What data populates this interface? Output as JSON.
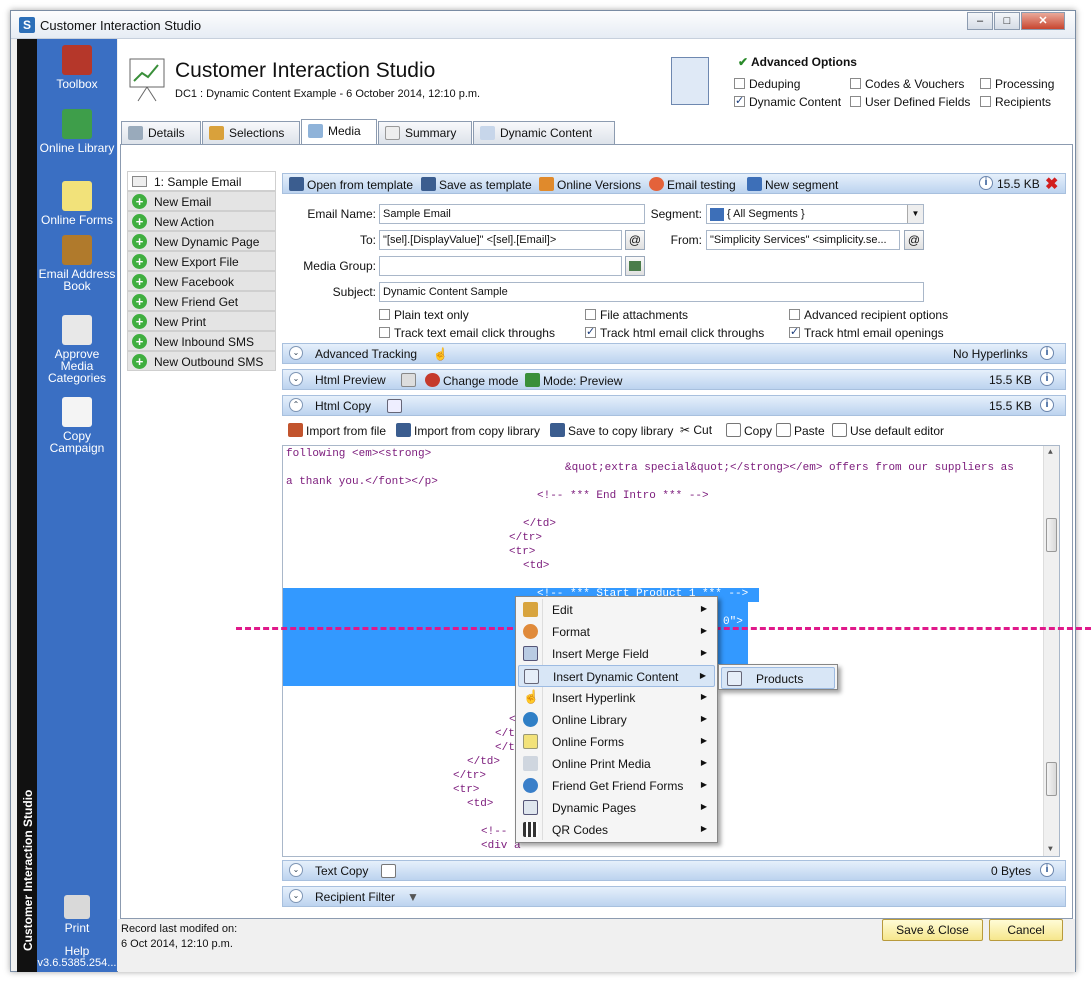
{
  "window": {
    "title": "Customer Interaction Studio"
  },
  "sidebar": {
    "vertical_label": "Customer Interaction Studio",
    "items": [
      {
        "label": "Toolbox",
        "icon": "toolbox-icon"
      },
      {
        "label": "Online Library",
        "icon": "globe-icon"
      },
      {
        "label": "Online Forms",
        "icon": "form-icon"
      },
      {
        "label": "Email Address Book",
        "icon": "address-book-icon"
      },
      {
        "label": "Approve Media Categories",
        "icon": "approve-icon"
      },
      {
        "label": "Copy Campaign",
        "icon": "copy-icon"
      },
      {
        "label": "Print",
        "icon": "printer-icon"
      },
      {
        "label": "Help",
        "icon": "help-icon"
      }
    ],
    "version": "v3.6.5385.254..."
  },
  "header": {
    "title": "Customer Interaction Studio",
    "subtitle": "DC1 : Dynamic Content Example - 6 October 2014, 12:10 p.m."
  },
  "advanced_options": {
    "title": "Advanced Options",
    "options": [
      {
        "label": "Deduping",
        "checked": false
      },
      {
        "label": "Codes & Vouchers",
        "checked": false
      },
      {
        "label": "Processing",
        "checked": false
      },
      {
        "label": "Dynamic Content",
        "checked": true
      },
      {
        "label": "User Defined Fields",
        "checked": false
      },
      {
        "label": "Recipients",
        "checked": false
      }
    ]
  },
  "tabs": [
    {
      "label": "Details"
    },
    {
      "label": "Selections"
    },
    {
      "label": "Media"
    },
    {
      "label": "Summary"
    },
    {
      "label": "Dynamic Content"
    }
  ],
  "email_list": [
    {
      "label": "1: Sample Email"
    },
    {
      "label": "New Email"
    },
    {
      "label": "New Action"
    },
    {
      "label": "New Dynamic Page"
    },
    {
      "label": "New Export File"
    },
    {
      "label": "New Facebook"
    },
    {
      "label": "New Friend Get Friend"
    },
    {
      "label": "New Print"
    },
    {
      "label": "New Inbound SMS"
    },
    {
      "label": "New Outbound SMS"
    }
  ],
  "toolbar": {
    "open_template": "Open from template",
    "save_template": "Save as template",
    "online_versions": "Online Versions",
    "email_testing": "Email testing",
    "new_segment": "New segment",
    "size": "15.5 KB"
  },
  "form": {
    "email_name_label": "Email Name:",
    "email_name": "Sample Email",
    "segment_label": "Segment:",
    "segment": "{ All Segments }",
    "to_label": "To:",
    "to": "\"[sel].[DisplayValue]\" <[sel].[Email]>",
    "from_label": "From:",
    "from": "\"Simplicity Services\" <simplicity.se...",
    "media_group_label": "Media Group:",
    "media_group": "",
    "subject_label": "Subject:",
    "subject": "Dynamic Content Sample"
  },
  "options": [
    {
      "label": "Plain text only",
      "checked": false
    },
    {
      "label": "File attachments",
      "checked": false
    },
    {
      "label": "Advanced recipient options",
      "checked": false
    },
    {
      "label": "Track text email click throughs",
      "checked": false
    },
    {
      "label": "Track html email click throughs",
      "checked": true
    },
    {
      "label": "Track html email openings",
      "checked": true
    }
  ],
  "sections": {
    "advanced_tracking": "Advanced Tracking",
    "no_hyperlinks": "No Hyperlinks",
    "html_preview": "Html Preview",
    "change_mode": "Change mode",
    "mode": "Mode: Preview",
    "preview_size": "15.5 KB",
    "html_copy": "Html Copy",
    "copy_size": "15.5 KB",
    "text_copy": "Text Copy",
    "text_size": "0 Bytes",
    "recipient_filter": "Recipient Filter"
  },
  "copy_toolbar": {
    "import_file": "Import from file",
    "import_library": "Import from copy library",
    "save_library": "Save to copy library",
    "cut": "Cut",
    "copy": "Copy",
    "paste": "Paste",
    "default_editor": "Use default editor"
  },
  "code_lines": [
    "following <em><strong>",
    "&quot;extra special&quot;</strong></em> offers from our suppliers as",
    "a thank you.</font></p>",
    "<!-- *** End Intro *** -->",
    "</td>",
    "</tr>",
    "<tr>",
    "<td>",
    "<!-- *** Start Product 1 *** -->",
    "0\">",
    "</",
    "</tb",
    "</tabl",
    "</td>",
    "</tr>",
    "<tr>",
    "<td>",
    "<!-- *",
    "<div a"
  ],
  "context_menu": [
    {
      "label": "Edit",
      "icon": "edit-icon"
    },
    {
      "label": "Format",
      "icon": "palette-icon"
    },
    {
      "label": "Insert Merge Field",
      "icon": "merge-field-icon"
    },
    {
      "label": "Insert Dynamic Content",
      "icon": "dynamic-content-icon"
    },
    {
      "label": "Insert Hyperlink",
      "icon": "hand-pointer-icon"
    },
    {
      "label": "Online Library",
      "icon": "globe-icon"
    },
    {
      "label": "Online Forms",
      "icon": "form-icon"
    },
    {
      "label": "Online Print Media",
      "icon": "print-media-icon"
    },
    {
      "label": "Friend Get Friend Forms",
      "icon": "people-icon"
    },
    {
      "label": "Dynamic Pages",
      "icon": "dynamic-page-icon"
    },
    {
      "label": "QR Codes",
      "icon": "qr-icon"
    }
  ],
  "submenu": {
    "label": "Products"
  },
  "footer": {
    "modified_label": "Record last modifed on:",
    "modified": "6 Oct 2014, 12:10 p.m.",
    "save_close": "Save & Close",
    "cancel": "Cancel"
  },
  "colors": {
    "sidebar": "#3a6fc3",
    "highlight": "#3399ff",
    "code_text": "#7b1a7b",
    "guide_line": "#e0198a"
  }
}
